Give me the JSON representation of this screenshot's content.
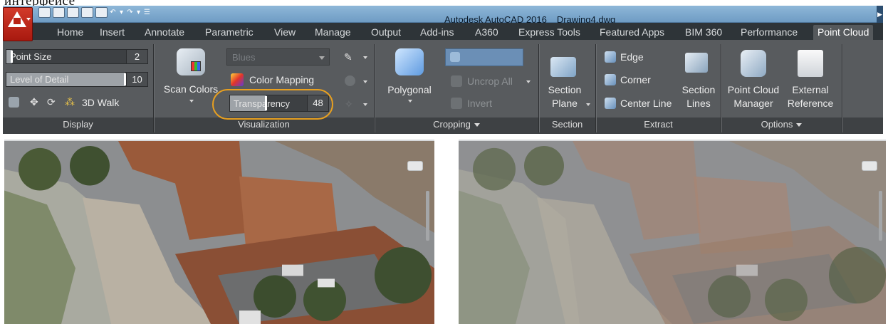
{
  "caption": "интерфейсе",
  "titlebar": {
    "app_name": "Autodesk AutoCAD 2016",
    "document": "Drawing4.dwg",
    "app_icon": "autocad-logo-icon",
    "qat_icons": [
      "new-icon",
      "open-icon",
      "save-icon",
      "save-as-icon",
      "print-icon",
      "undo-icon",
      "redo-icon",
      "customize-icon"
    ]
  },
  "tabs": [
    {
      "label": "Home"
    },
    {
      "label": "Insert"
    },
    {
      "label": "Annotate"
    },
    {
      "label": "Parametric"
    },
    {
      "label": "View"
    },
    {
      "label": "Manage"
    },
    {
      "label": "Output"
    },
    {
      "label": "Add-ins"
    },
    {
      "label": "A360"
    },
    {
      "label": "Express Tools"
    },
    {
      "label": "Featured Apps"
    },
    {
      "label": "BIM 360"
    },
    {
      "label": "Performance"
    },
    {
      "label": "Point Cloud"
    }
  ],
  "active_tab": "Point Cloud",
  "display": {
    "title": "Display",
    "point_size": {
      "label": "Point Size",
      "value": "2",
      "level": 0.05
    },
    "level_of_detail": {
      "label": "Level of Detail",
      "value": "10",
      "level": 1.0
    },
    "walk_label": "3D Walk"
  },
  "visualization": {
    "title": "Visualization",
    "scan_colors": "Scan Colors",
    "color_scheme": "Blues",
    "color_mapping": "Color Mapping",
    "transparency": {
      "label": "Transparency",
      "value": "48",
      "level": 0.48
    }
  },
  "cropping": {
    "title": "Cropping",
    "polygonal": "Polygonal",
    "uncrop_all": "Uncrop All",
    "invert": "Invert"
  },
  "section": {
    "title": "Section",
    "section_plane": [
      "Section",
      "Plane"
    ]
  },
  "extract": {
    "title": "Extract",
    "edge": "Edge",
    "corner": "Corner",
    "center_line": "Center Line",
    "section_lines": [
      "Section",
      "Lines"
    ]
  },
  "options": {
    "title": "Options",
    "point_cloud_manager": [
      "Point Cloud",
      "Manager"
    ],
    "external_reference": [
      "External",
      "Reference"
    ]
  },
  "colors": {
    "accent_highlight": "#e8a020",
    "ribbon": "#585b5e",
    "titlebar": "#7aa6cd"
  }
}
